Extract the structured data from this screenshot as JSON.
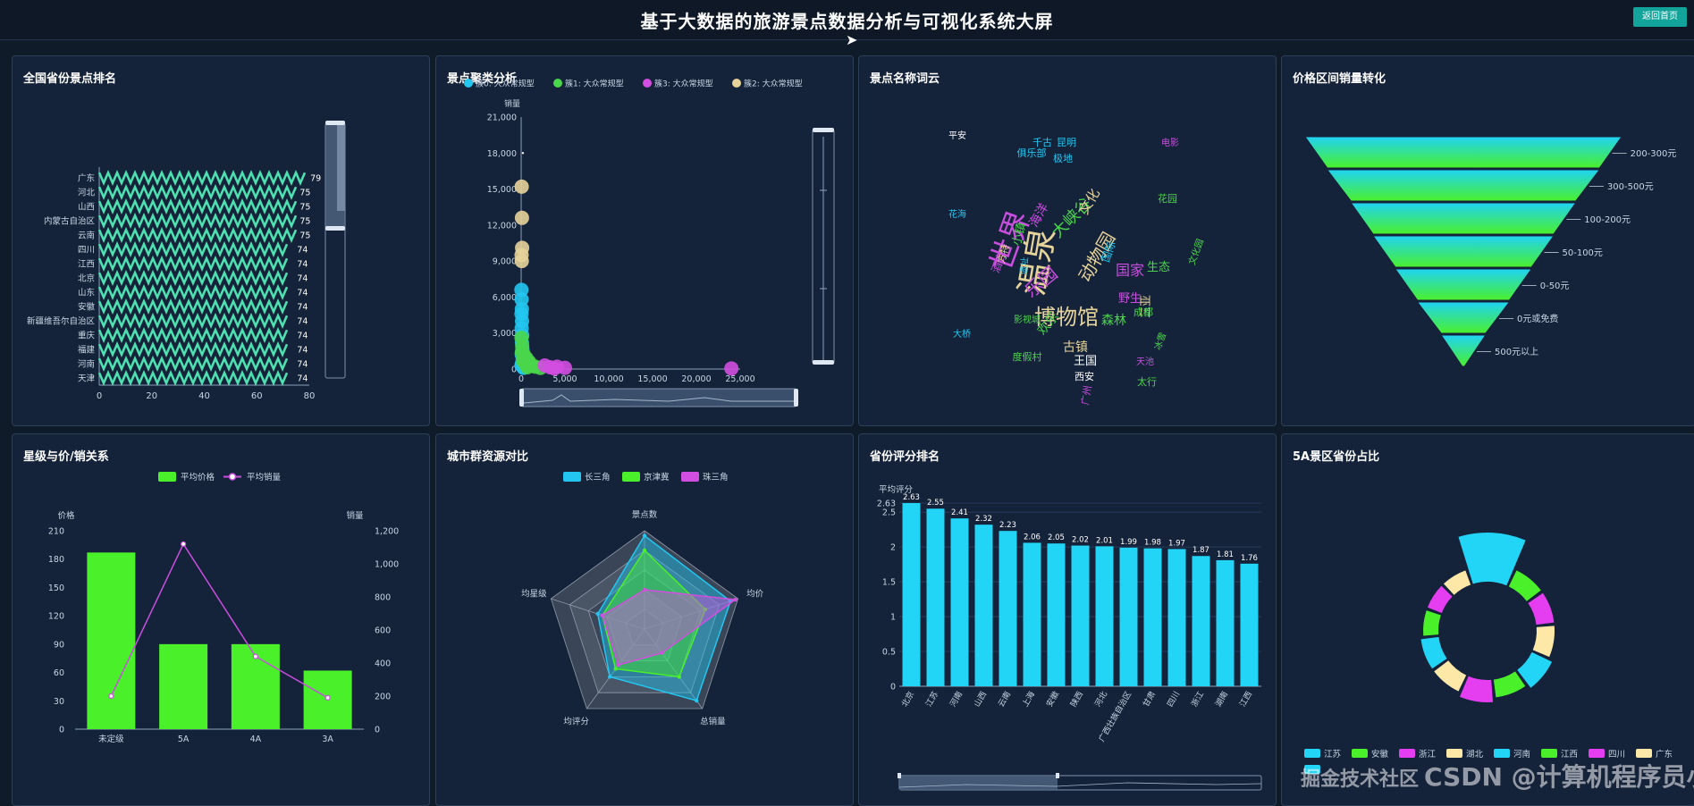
{
  "header": {
    "title": "基于大数据的旅游景点数据分析与可视化系统大屏",
    "back_label": "返回首页"
  },
  "panels": {
    "p1": "全国省份景点排名",
    "p2": "景点聚类分析",
    "p3": "景点名称词云",
    "p4": "价格区间销量转化",
    "p5": "星级与价/销关系",
    "p6": "城市群资源对比",
    "p7": "省份评分排名",
    "p8": "5A景区省份占比"
  },
  "watermark": "CSDN @计算机程序员小杨",
  "watermark_overlay": "掘金技术社区",
  "chart_data": [
    {
      "id": "province-ranking",
      "type": "bar",
      "orientation": "horizontal",
      "categories": [
        "广东",
        "河北",
        "山西",
        "内蒙古自治区",
        "云南",
        "四川",
        "江西",
        "北京",
        "山东",
        "安徽",
        "新疆维吾尔自治区",
        "重庆",
        "福建",
        "河南",
        "天津"
      ],
      "values": [
        79,
        75,
        75,
        75,
        75,
        74,
        74,
        74,
        74,
        74,
        74,
        74,
        74,
        74,
        74
      ],
      "xticks": [
        "0",
        "20",
        "40",
        "60",
        "80"
      ],
      "xlim": [
        0,
        80
      ],
      "color": "#4de0b0"
    },
    {
      "id": "cluster-scatter",
      "type": "scatter",
      "legend": [
        "簇0: 大众常规型",
        "簇1: 大众常规型",
        "簇3: 大众常规型",
        "簇2: 大众常规型"
      ],
      "ylabel": "销量",
      "yticks": [
        "21,000",
        "18,000",
        "15,000",
        "12,000",
        "9,000",
        "6,000",
        "3,000",
        "0"
      ],
      "xticks": [
        "0",
        "5,000",
        "10,000",
        "15,000",
        "20,000",
        "25,000"
      ],
      "xlim": [
        0,
        25000
      ],
      "ylim": [
        0,
        21000
      ],
      "series": [
        {
          "name": "簇0: 大众常规型",
          "color": "#22c6f0",
          "points": [
            [
              30,
              6600
            ],
            [
              50,
              5800
            ],
            [
              80,
              5000
            ],
            [
              40,
              4600
            ],
            [
              100,
              4000
            ],
            [
              60,
              3400
            ],
            [
              120,
              2800
            ],
            [
              90,
              2200
            ],
            [
              150,
              1600
            ],
            [
              70,
              1200
            ],
            [
              180,
              800
            ],
            [
              110,
              500
            ],
            [
              220,
              200
            ],
            [
              40,
              300
            ],
            [
              260,
              100
            ]
          ]
        },
        {
          "name": "簇1: 大众常规型",
          "color": "#4ad64a",
          "points": [
            [
              40,
              2600
            ],
            [
              120,
              1900
            ],
            [
              300,
              1200
            ],
            [
              600,
              900
            ],
            [
              900,
              600
            ],
            [
              1200,
              300
            ],
            [
              80,
              1400
            ],
            [
              500,
              400
            ],
            [
              1600,
              200
            ],
            [
              2200,
              100
            ],
            [
              200,
              700
            ],
            [
              700,
              150
            ]
          ]
        },
        {
          "name": "簇3: 大众常规型",
          "color": "#d24ee0",
          "points": [
            [
              2700,
              300
            ],
            [
              3300,
              150
            ],
            [
              4100,
              200
            ],
            [
              5000,
              100
            ],
            [
              3800,
              50
            ],
            [
              24000,
              50
            ]
          ]
        },
        {
          "name": "簇2: 大众常规型",
          "color": "#e6d39a",
          "points": [
            [
              60,
              15200
            ],
            [
              90,
              12600
            ],
            [
              110,
              10100
            ],
            [
              50,
              9500
            ],
            [
              70,
              9000
            ]
          ]
        }
      ]
    },
    {
      "id": "name-wordcloud",
      "type": "wordcloud",
      "words": [
        {
          "text": "温泉",
          "size": 38,
          "color": "#e6d39a"
        },
        {
          "text": "世界",
          "size": 34,
          "color": "#c94ee0"
        },
        {
          "text": "博物馆",
          "size": 24,
          "color": "#e6d39a"
        },
        {
          "text": "动物园",
          "size": 20,
          "color": "#e6d39a"
        },
        {
          "text": "乐园",
          "size": 20,
          "color": "#c94ee0"
        },
        {
          "text": "大峡谷",
          "size": 18,
          "color": "#4ad64a"
        },
        {
          "text": "国家",
          "size": 16,
          "color": "#c94ee0"
        },
        {
          "text": "古镇",
          "size": 14,
          "color": "#e6d39a"
        },
        {
          "text": "森林",
          "size": 14,
          "color": "#4ad64a"
        },
        {
          "text": "海洋",
          "size": 14,
          "color": "#c94ee0"
        },
        {
          "text": "文化",
          "size": 15,
          "color": "#e6d39a"
        },
        {
          "text": "欢乐",
          "size": 14,
          "color": "#4ad64a"
        },
        {
          "text": "生态",
          "size": 13,
          "color": "#4ad64a"
        },
        {
          "text": "野生",
          "size": 13,
          "color": "#c94ee0"
        },
        {
          "text": "三亚",
          "size": 13,
          "color": "#e6d39a"
        },
        {
          "text": "王国",
          "size": 13,
          "color": "#ffffff"
        },
        {
          "text": "小镇",
          "size": 13,
          "color": "#4ad64a"
        },
        {
          "text": "酒店",
          "size": 12,
          "color": "#c94ee0"
        },
        {
          "text": "国际",
          "size": 12,
          "color": "#22c6f0"
        },
        {
          "text": "花园",
          "size": 11,
          "color": "#4ad64a"
        },
        {
          "text": "千古",
          "size": 11,
          "color": "#22c6f0"
        },
        {
          "text": "昆明",
          "size": 11,
          "color": "#22c6f0"
        },
        {
          "text": "极地",
          "size": 11,
          "color": "#22c6f0"
        },
        {
          "text": "俱乐部",
          "size": 11,
          "color": "#22c6f0"
        },
        {
          "text": "平安",
          "size": 10,
          "color": "#ffffff"
        },
        {
          "text": "西安",
          "size": 11,
          "color": "#ffffff"
        },
        {
          "text": "广州",
          "size": 11,
          "color": "#c94ee0"
        },
        {
          "text": "太行",
          "size": 11,
          "color": "#4ad64a"
        },
        {
          "text": "成都",
          "size": 11,
          "color": "#4ad64a"
        },
        {
          "text": "度假村",
          "size": 11,
          "color": "#4ad64a"
        },
        {
          "text": "影视城",
          "size": 10,
          "color": "#4ad64a"
        },
        {
          "text": "大桥",
          "size": 10,
          "color": "#22c6f0"
        },
        {
          "text": "方特",
          "size": 11,
          "color": "#e6d39a"
        },
        {
          "text": "电影",
          "size": 10,
          "color": "#c94ee0"
        },
        {
          "text": "天池",
          "size": 10,
          "color": "#c94ee0"
        },
        {
          "text": "花海",
          "size": 10,
          "color": "#22c6f0"
        },
        {
          "text": "冰雪",
          "size": 10,
          "color": "#4ad64a"
        },
        {
          "text": "遗址",
          "size": 10,
          "color": "#22c6f0"
        },
        {
          "text": "文化园",
          "size": 10,
          "color": "#4ad64a"
        }
      ]
    },
    {
      "id": "price-funnel",
      "type": "funnel",
      "categories": [
        "200-300元",
        "300-500元",
        "100-200元",
        "50-100元",
        "0-50元",
        "0元或免费",
        "500元以上"
      ],
      "values": [
        100,
        86,
        71,
        57,
        43,
        29,
        14
      ]
    },
    {
      "id": "star-price-sales",
      "type": "bar",
      "legend": [
        "平均价格",
        "平均销量"
      ],
      "categories": [
        "未定级",
        "5A",
        "4A",
        "3A"
      ],
      "series": [
        {
          "name": "平均价格",
          "type": "bar",
          "values": [
            187,
            90,
            90,
            62
          ],
          "color": "#4af02a"
        },
        {
          "name": "平均销量",
          "type": "line",
          "values": [
            200,
            1120,
            440,
            190
          ],
          "color": "#c94ee0"
        }
      ],
      "ylabel": "价格",
      "ylabel2": "销量",
      "ylim": [
        0,
        210
      ],
      "ylim2": [
        0,
        1200
      ],
      "yticks": [
        "0",
        "30",
        "60",
        "90",
        "120",
        "150",
        "180",
        "210"
      ],
      "yticks2": [
        "0",
        "200",
        "400",
        "600",
        "800",
        "1,000",
        "1,200"
      ]
    },
    {
      "id": "city-cluster-radar",
      "type": "radar",
      "legend": [
        "长三角",
        "京津冀",
        "珠三角"
      ],
      "indicators": [
        "景点数",
        "均价",
        "总销量",
        "均评分",
        "均星级"
      ],
      "series": [
        {
          "name": "长三角",
          "color": "#22c6f0",
          "values": [
            0.95,
            0.92,
            0.9,
            0.6,
            0.5
          ]
        },
        {
          "name": "京津冀",
          "color": "#4af02a",
          "values": [
            0.8,
            0.65,
            0.6,
            0.5,
            0.45
          ]
        },
        {
          "name": "珠三角",
          "color": "#d24ee0",
          "values": [
            0.4,
            0.97,
            0.3,
            0.45,
            0.45
          ]
        }
      ]
    },
    {
      "id": "province-rating",
      "type": "bar",
      "ylabel": "平均评分",
      "categories": [
        "北京",
        "江苏",
        "河南",
        "山西",
        "云南",
        "上海",
        "安徽",
        "陕西",
        "河北",
        "广西壮族自治区",
        "甘肃",
        "四川",
        "浙江",
        "湖南",
        "江西"
      ],
      "values": [
        2.63,
        2.55,
        2.41,
        2.32,
        2.23,
        2.06,
        2.05,
        2.02,
        2.01,
        1.99,
        1.98,
        1.97,
        1.87,
        1.81,
        1.76
      ],
      "labels": [
        "2.63",
        "2.55",
        "2.41",
        "2.32",
        "2.23",
        "2.06",
        "2.05",
        "2.02",
        "2.01",
        "1.99",
        "1.98",
        "1.97",
        "1.87",
        "1.81",
        "1.76"
      ],
      "yticks": [
        "0",
        "0.5",
        "1",
        "1.5",
        "2",
        "2.5",
        "2.63"
      ],
      "ylim": [
        0,
        2.63
      ],
      "color": "#22d4f5"
    },
    {
      "id": "5a-province-share",
      "type": "pie",
      "style": "rose-donut",
      "legend": [
        "江苏",
        "安徽",
        "浙江",
        "湖北",
        "河南",
        "江西",
        "四川",
        "广东"
      ],
      "colors": [
        "#22d4f5",
        "#4af02a",
        "#e43ef0",
        "#fde8a8",
        "#22d4f5",
        "#4af02a",
        "#e43ef0",
        "#fde8a8"
      ],
      "values": [
        10,
        7,
        7,
        7,
        7,
        7,
        7,
        7,
        7,
        6,
        6,
        6
      ]
    }
  ]
}
